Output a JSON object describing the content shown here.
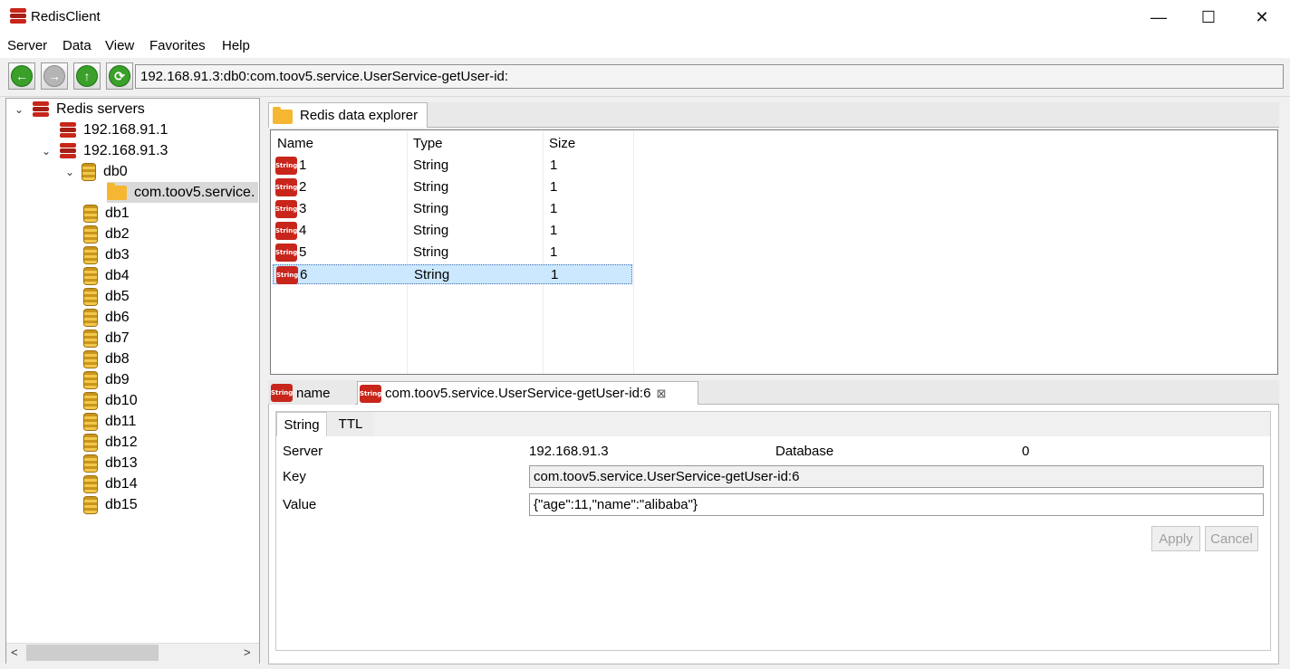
{
  "window": {
    "title": "RedisClient",
    "controls": {
      "minimize": "—",
      "maximize": "☐",
      "close": "✕"
    }
  },
  "menu": [
    "Server",
    "Data",
    "View",
    "Favorites",
    "Help"
  ],
  "toolbar": {
    "buttons": [
      "back-icon",
      "forward-icon",
      "up-icon",
      "refresh-icon"
    ],
    "address": "192.168.91.3:db0:com.toov5.service.UserService-getUser-id:"
  },
  "tree": {
    "root": "Redis servers",
    "servers": [
      "192.168.91.1",
      "192.168.91.3"
    ],
    "db0": "db0",
    "folder": "com.toov5.service.",
    "dbs": [
      "db1",
      "db2",
      "db3",
      "db4",
      "db5",
      "db6",
      "db7",
      "db8",
      "db9",
      "db10",
      "db11",
      "db12",
      "db13",
      "db14",
      "db15"
    ]
  },
  "explorer": {
    "tab": "Redis data explorer",
    "columns": [
      "Name",
      "Type",
      "Size"
    ],
    "icon_label": "String",
    "rows": [
      {
        "name": "1",
        "type": "String",
        "size": "1"
      },
      {
        "name": "2",
        "type": "String",
        "size": "1"
      },
      {
        "name": "3",
        "type": "String",
        "size": "1"
      },
      {
        "name": "4",
        "type": "String",
        "size": "1"
      },
      {
        "name": "5",
        "type": "String",
        "size": "1"
      },
      {
        "name": "6",
        "type": "String",
        "size": "1"
      }
    ]
  },
  "detail": {
    "tabs": [
      "name",
      "com.toov5.service.UserService-getUser-id:6"
    ],
    "close": "⊠",
    "inner_tabs": [
      "String",
      "TTL"
    ],
    "labels": {
      "server": "Server",
      "database": "Database",
      "key": "Key",
      "value": "Value"
    },
    "server": "192.168.91.3",
    "database": "0",
    "key": "com.toov5.service.UserService-getUser-id:6",
    "value": "{\"age\":11,\"name\":\"alibaba\"}",
    "apply": "Apply",
    "cancel": "Cancel"
  },
  "colors": {
    "redis_red": "#c8261b",
    "selection": "#cce8ff",
    "folder": "#f5b731"
  }
}
